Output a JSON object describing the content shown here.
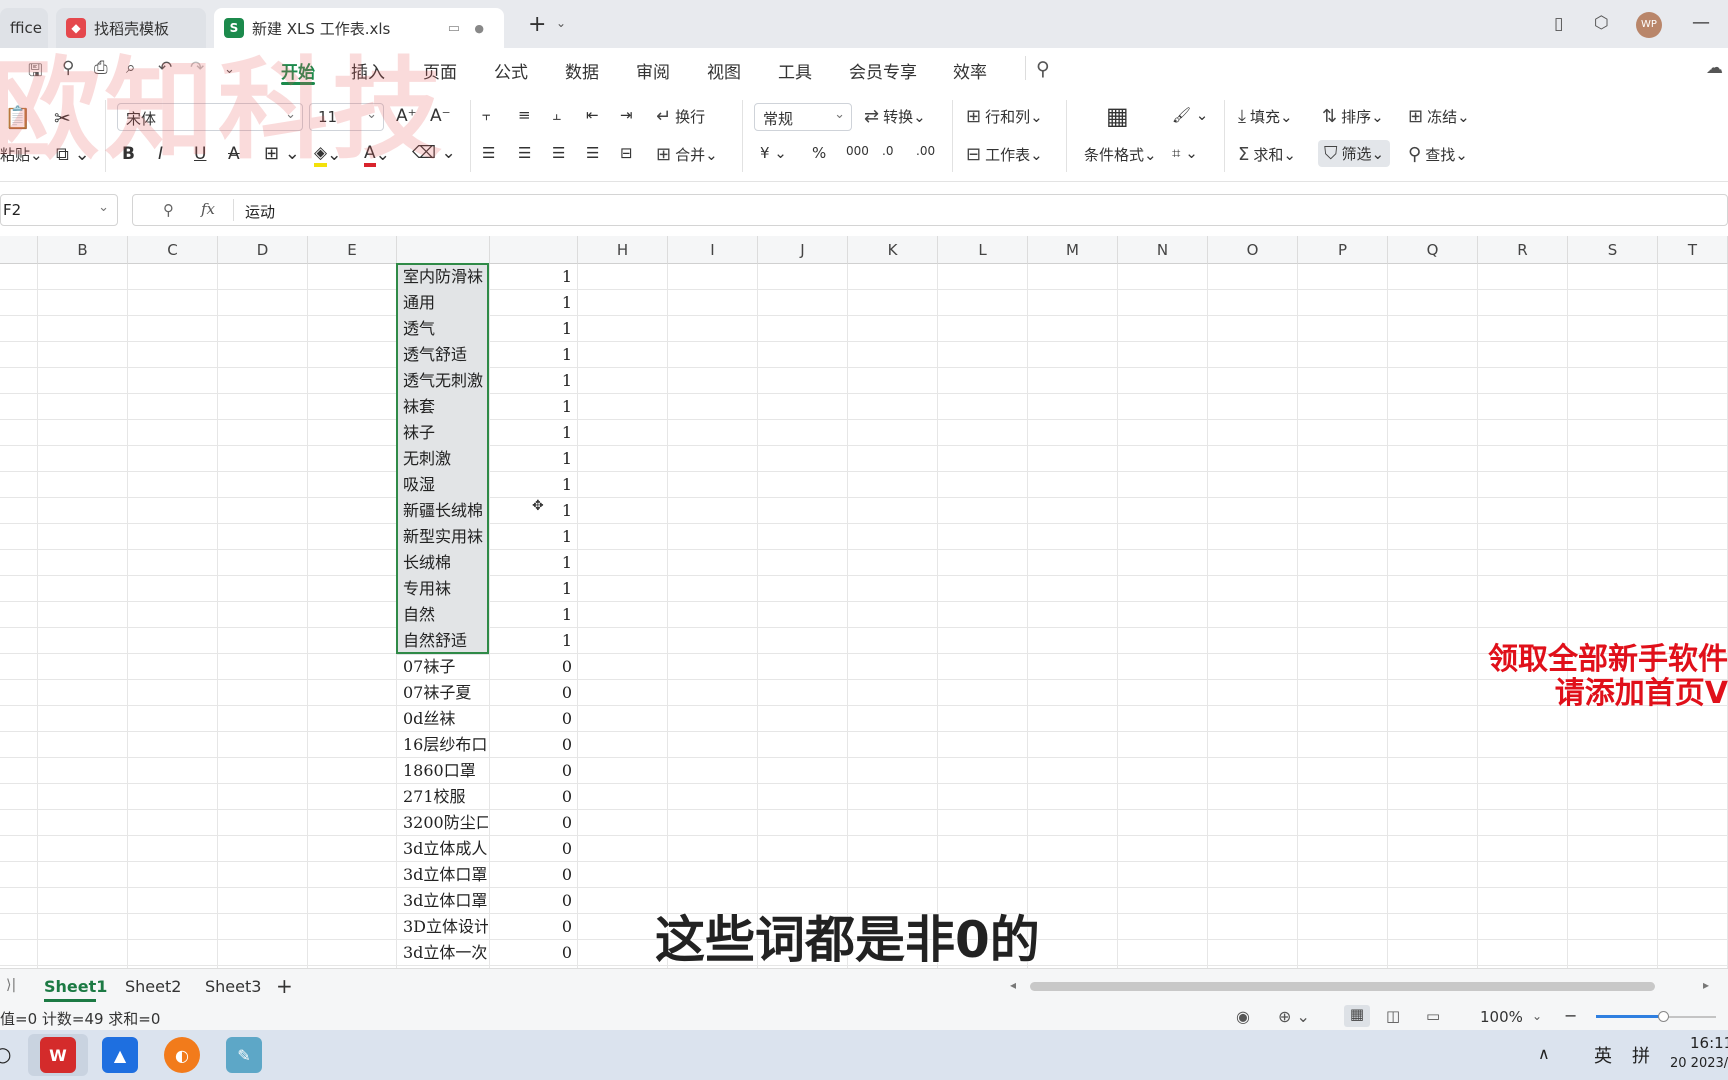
{
  "tabs": [
    {
      "label": "ffice"
    },
    {
      "label": "找稻壳模板",
      "icon": "docer-icon",
      "icon_color": "#e5484d"
    },
    {
      "label": "新建 XLS 工作表.xls",
      "icon_text": "S",
      "icon_color": "#1c8a4c"
    }
  ],
  "user": {
    "avatar_text": "WP",
    "avatar_color": "#b9866a"
  },
  "menu": {
    "items": [
      "开始",
      "插入",
      "页面",
      "公式",
      "数据",
      "审阅",
      "视图",
      "工具",
      "会员专享",
      "效率"
    ],
    "active": "开始",
    "accent": "#1c8a4c"
  },
  "ribbon": {
    "paste": "粘贴",
    "font_name": "宋体",
    "font_size": "11",
    "wrap": "换行",
    "merge": "合并",
    "number_format": "常规",
    "convert": "转换",
    "rows_cols": "行和列",
    "worksheet": "工作表",
    "cond_format": "条件格式",
    "fill": "填充",
    "sort": "排序",
    "freeze": "冻结",
    "sum": "求和",
    "filter": "筛选",
    "find": "查找"
  },
  "formula_bar": {
    "cell_ref": "F2",
    "fx": "fx",
    "value": "运动"
  },
  "columns": [
    "B",
    "C",
    "D",
    "E",
    "",
    "",
    "H",
    "I",
    "J",
    "K",
    "L",
    "M",
    "N",
    "O",
    "P",
    "Q",
    "R",
    "S",
    "T"
  ],
  "rows": [
    {
      "f": "室内防滑袜",
      "g": "1"
    },
    {
      "f": "通用",
      "g": "1"
    },
    {
      "f": "透气",
      "g": "1"
    },
    {
      "f": "透气舒适",
      "g": "1"
    },
    {
      "f": "透气无刺激",
      "g": "1"
    },
    {
      "f": "袜套",
      "g": "1"
    },
    {
      "f": "袜子",
      "g": "1"
    },
    {
      "f": "无刺激",
      "g": "1"
    },
    {
      "f": "吸湿",
      "g": "1"
    },
    {
      "f": "新疆长绒棉",
      "g": "1"
    },
    {
      "f": "新型实用袜",
      "g": "1"
    },
    {
      "f": "长绒棉",
      "g": "1"
    },
    {
      "f": "专用袜",
      "g": "1"
    },
    {
      "f": "自然",
      "g": "1"
    },
    {
      "f": "自然舒适",
      "g": "1"
    },
    {
      "f": "07袜子",
      "g": "0"
    },
    {
      "f": "07袜子夏",
      "g": "0"
    },
    {
      "f": "0d丝袜",
      "g": "0"
    },
    {
      "f": "16层纱布口",
      "g": "0"
    },
    {
      "f": "1860口罩",
      "g": "0"
    },
    {
      "f": "271校服",
      "g": "0"
    },
    {
      "f": "3200防尘口",
      "g": "0"
    },
    {
      "f": "3d立体成人",
      "g": "0"
    },
    {
      "f": "3d立体口罩",
      "g": "0"
    },
    {
      "f": "3d立体口罩",
      "g": "0"
    },
    {
      "f": "3D立体设计",
      "g": "0"
    },
    {
      "f": "3d立体一次",
      "g": "0"
    }
  ],
  "sheets": [
    "Sheet1",
    "Sheet2",
    "Sheet3"
  ],
  "active_sheet": "Sheet1",
  "status": {
    "summary": "值=0  计数=49  求和=0",
    "zoom": "100%"
  },
  "taskbar": {
    "ime_lang": "英",
    "ime_mode": "拼",
    "time": "16:11",
    "date": "20 2023/"
  },
  "overlay": {
    "watermark": "欧知科技",
    "promo_line1": "领取全部新手软件",
    "promo_line2": "请添加首页V",
    "subtitle": "这些词都是非0的"
  }
}
